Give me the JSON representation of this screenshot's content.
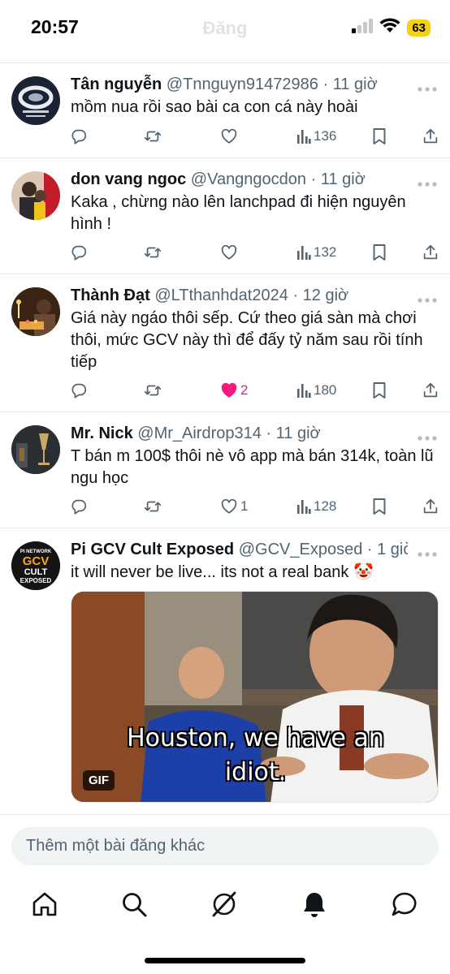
{
  "status_bar": {
    "time": "20:57",
    "title": "Đăng",
    "battery": "63"
  },
  "tweets": [
    {
      "name": "Tân nguyễn",
      "handle": "@Tnnguyn91472986",
      "time": "· 11 giờ",
      "text": "mồm nua rồi sao bài ca con cá này hoài",
      "likes": "",
      "views": "136"
    },
    {
      "name": "don vang ngoc",
      "handle": "@Vangngocdon",
      "time": "· 11 giờ",
      "text": "Kaka , chừng nào lên lanchpad đi hiện nguyên hình !",
      "likes": "",
      "views": "132"
    },
    {
      "name": "Thành Đạt",
      "handle": "@LTthanhdat2024",
      "time": "· 12 giờ",
      "text": "Giá này ngáo thôi sếp. Cứ theo giá sàn mà chơi thôi, mức GCV này thì để đấy tỷ năm sau rồi tính tiếp",
      "likes": "2",
      "views": "180"
    },
    {
      "name": "Mr. Nick",
      "handle": "@Mr_Airdrop314",
      "time": "· 11 giờ",
      "text": "T bán m 100$ thôi nè vô app mà bán 314k, toàn lũ ngu học",
      "likes": "1",
      "views": "128"
    },
    {
      "name": "Pi GCV Cult Exposed",
      "handle": "@GCV_Exposed",
      "time": "· 1 giờ",
      "text": "it will never be live... its not a real bank 🤡",
      "avatar_lines": [
        "PI NETWORK",
        "GCV",
        "CULT",
        "EXPOSED"
      ],
      "media": {
        "caption_line1": "Houston, we have an",
        "caption_line2": "idiot.",
        "badge": "GIF"
      }
    }
  ],
  "reply": {
    "placeholder": "Thêm một bài đăng khác"
  },
  "colors": {
    "text": "#0f1419",
    "muted": "#536471",
    "like": "#f91880",
    "battery": "#f5d20b"
  },
  "nav_icons": [
    "home-icon",
    "search-icon",
    "grok-icon",
    "notifications-icon",
    "messages-icon"
  ]
}
